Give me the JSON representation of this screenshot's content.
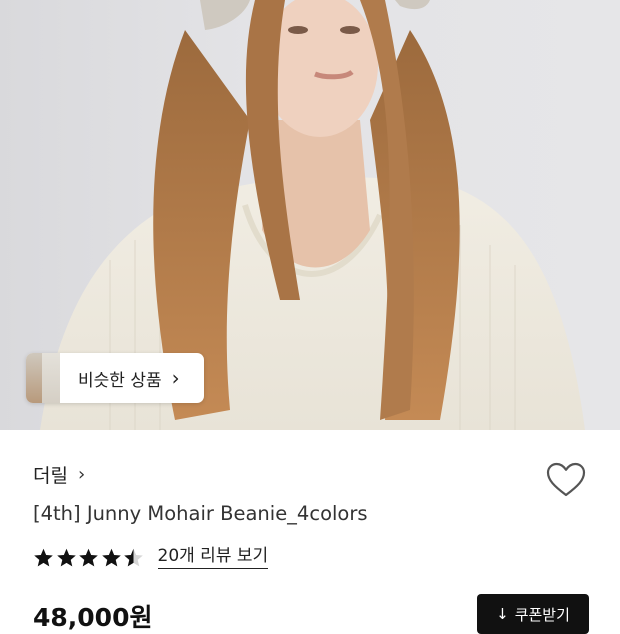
{
  "product_image": {
    "alt_icon": "product-photo"
  },
  "similar_products": {
    "label": "비슷한 상품",
    "chevron": "›"
  },
  "brand": {
    "name": "더릴",
    "chevron": "›"
  },
  "product": {
    "title": "[4th] Junny Mohair Beanie_4colors",
    "rating": 4.5,
    "review_link": "20개 리뷰 보기",
    "price": "48,000원"
  },
  "coupon": {
    "label": "쿠폰받기",
    "arrow": "↓"
  },
  "colors": {
    "accent": "#111111",
    "star": "#111111",
    "text": "#222222"
  }
}
